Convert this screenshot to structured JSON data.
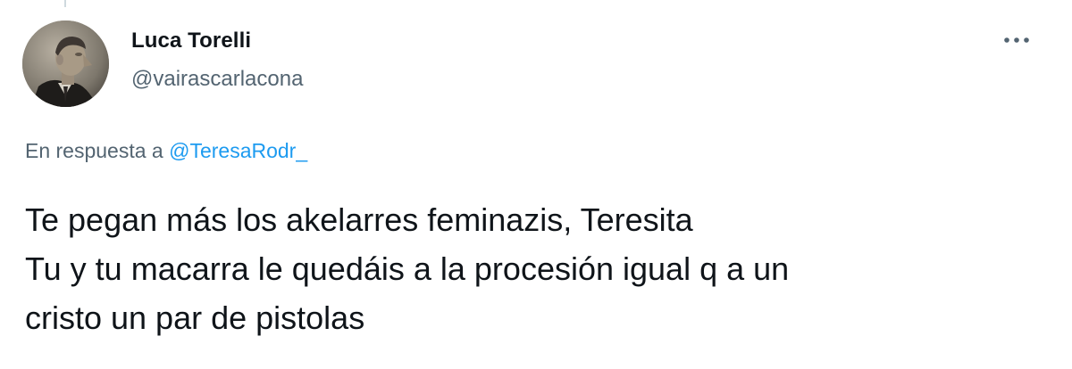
{
  "author": {
    "name": "Luca Torelli",
    "handle": "@vairascarlacona",
    "avatar_icon": "profile-photo"
  },
  "menu": {
    "icon": "more-horizontal-icon",
    "glyph": "•••"
  },
  "reply": {
    "prefix": "En respuesta a",
    "handle": "@TeresaRodr_"
  },
  "tweet": {
    "lines": [
      "Te pegan más los akelarres feminazis, Teresita",
      "Tu y tu macarra le quedáis a la procesión igual q a un",
      "cristo un par de pistolas"
    ]
  },
  "colors": {
    "text": "#0f1419",
    "secondary": "#536471",
    "link": "#1d9bf0",
    "thread_line": "#cfd9de"
  }
}
